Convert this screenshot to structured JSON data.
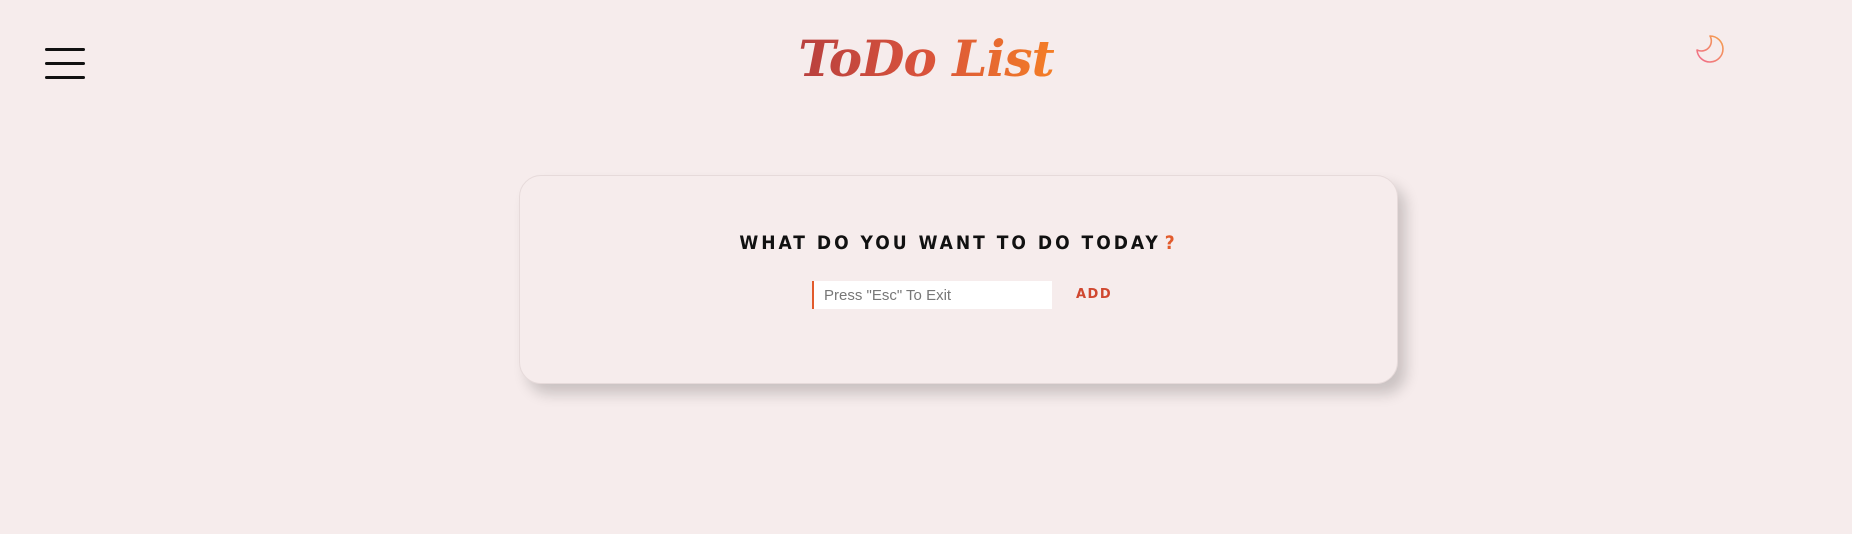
{
  "header": {
    "title": "ToDo List",
    "menu_icon": "hamburger-menu-icon",
    "theme_icon": "moon-icon"
  },
  "colors": {
    "background": "#f6ecec",
    "accent": "#e25b2c",
    "gradient_start": "#b8403f",
    "gradient_end": "#f47e26"
  },
  "main": {
    "prompt": "WHAT DO YOU WANT TO DO TODAY",
    "prompt_mark": "?",
    "input": {
      "value": "",
      "placeholder": "Press \"Esc\" To Exit"
    },
    "add_label": "ADD"
  }
}
